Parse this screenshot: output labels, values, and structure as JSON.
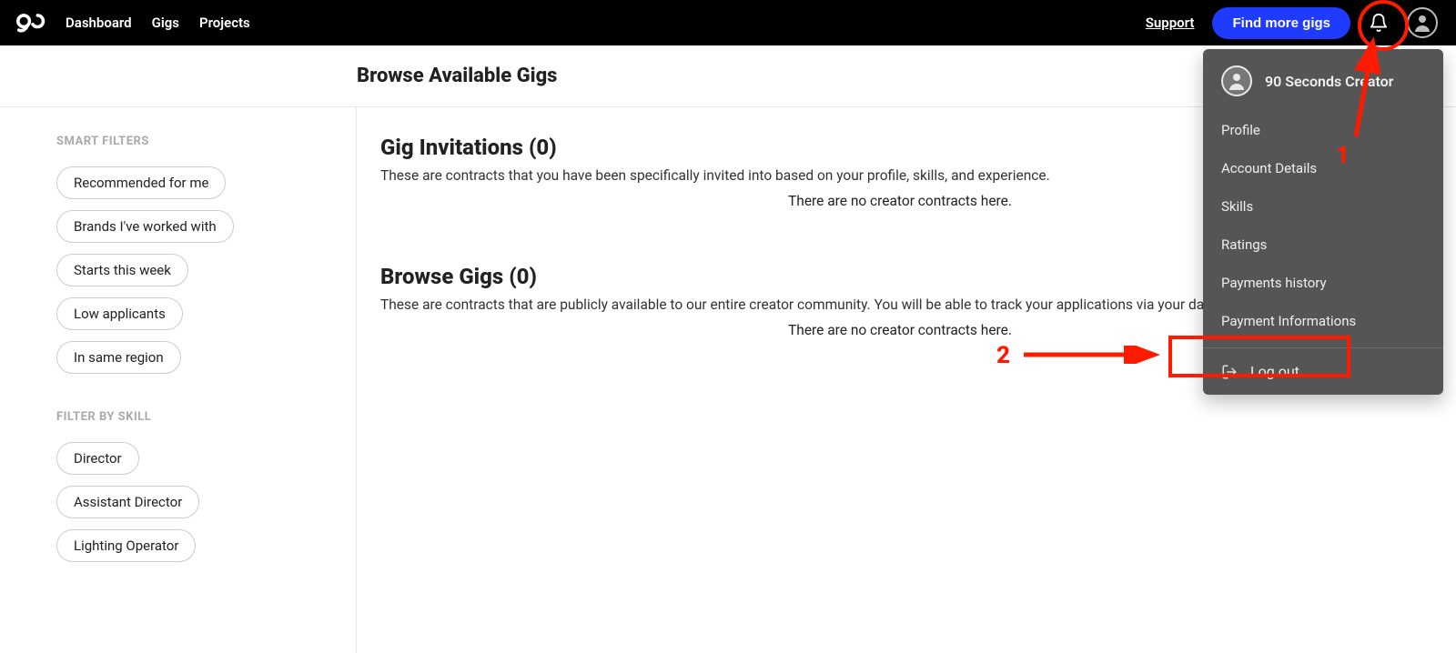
{
  "nav": {
    "links": [
      "Dashboard",
      "Gigs",
      "Projects"
    ],
    "support": "Support",
    "cta": "Find more gigs"
  },
  "page_title": "Browse Available Gigs",
  "sidebar": {
    "smart_heading": "SMART FILTERS",
    "smart_filters": [
      "Recommended for me",
      "Brands I've worked with",
      "Starts this week",
      "Low applicants",
      "In same region"
    ],
    "skill_heading": "FILTER BY SKILL",
    "skill_filters": [
      "Director",
      "Assistant Director",
      "Lighting Operator"
    ]
  },
  "sections": {
    "invitations": {
      "title": "Gig Invitations (0)",
      "desc": "These are contracts that you have been specifically invited into based on your profile, skills, and experience.",
      "empty": "There are no creator contracts here."
    },
    "browse": {
      "title": "Browse Gigs (0)",
      "desc": "These are contracts that are publicly available to our entire creator community. You will be able to track your applications via your dashboard if successful.",
      "empty": "There are no creator contracts here."
    }
  },
  "dropdown": {
    "user_name": "90 Seconds Creator",
    "items": [
      "Profile",
      "Account Details",
      "Skills",
      "Ratings",
      "Payments history",
      "Payment Informations"
    ],
    "logout": "Log out"
  },
  "annotations": {
    "num1": "1",
    "num2": "2"
  }
}
